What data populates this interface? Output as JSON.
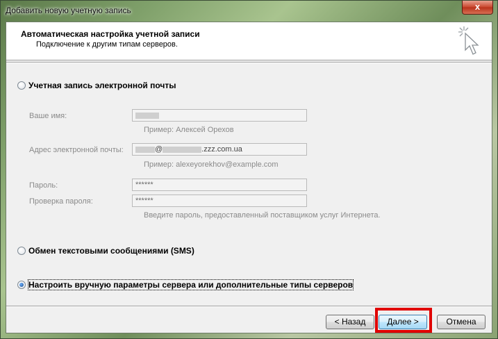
{
  "window": {
    "title": "Добавить новую учетную запись",
    "close": "x"
  },
  "header": {
    "title": "Автоматическая настройка учетной записи",
    "subtitle": "Подключение к другим типам серверов."
  },
  "options": {
    "email": {
      "label": "Учетная запись электронной почты",
      "selected": false
    },
    "sms": {
      "label": "Обмен текстовыми сообщениями (SMS)",
      "selected": false
    },
    "manual": {
      "label": "Настроить вручную параметры сервера или дополнительные типы серверов",
      "selected": true
    }
  },
  "form": {
    "name": {
      "label": "Ваше имя:",
      "value": "",
      "hint": "Пример: Алексей Орехов"
    },
    "email": {
      "label": "Адрес электронной почты:",
      "value_at": "@",
      "value_domain": ".zzz.com.ua",
      "hint": "Пример: alexeyorekhov@example.com"
    },
    "password": {
      "label": "Пароль:",
      "value": "******"
    },
    "password_confirm": {
      "label": "Проверка пароля:",
      "value": "******"
    },
    "password_hint": "Введите пароль, предоставленный поставщиком услуг Интернета."
  },
  "buttons": {
    "back": "< Назад",
    "next": "Далее >",
    "cancel": "Отмена"
  }
}
